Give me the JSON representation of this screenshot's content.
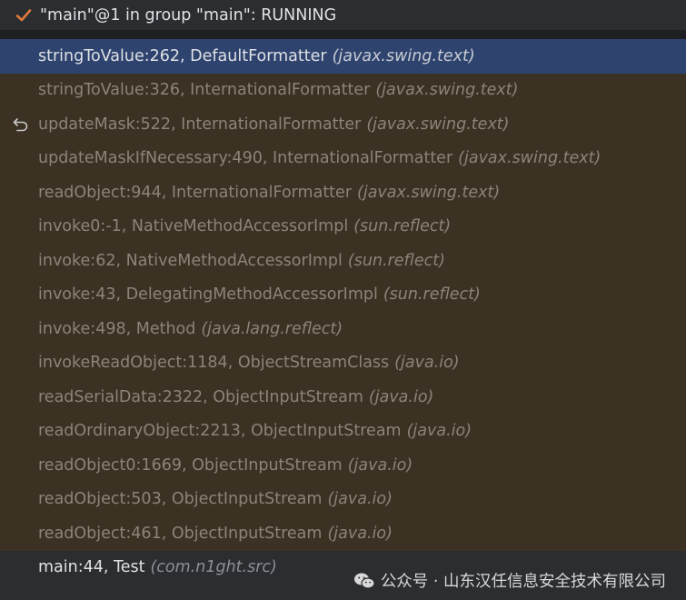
{
  "thread": {
    "title": "\"main\"@1 in group \"main\": RUNNING",
    "status_icon": "check-icon",
    "status_color": "#e07a3a"
  },
  "frames": [
    {
      "location": "stringToValue:262, DefaultFormatter",
      "package": "(javax.swing.text)",
      "kind": "selected"
    },
    {
      "location": "stringToValue:326, InternationalFormatter",
      "package": "(javax.swing.text)",
      "kind": "library"
    },
    {
      "location": "updateMask:522, InternationalFormatter",
      "package": "(javax.swing.text)",
      "kind": "library",
      "icon": "drop-frame-icon"
    },
    {
      "location": "updateMaskIfNecessary:490, InternationalFormatter",
      "package": "(javax.swing.text)",
      "kind": "library"
    },
    {
      "location": "readObject:944, InternationalFormatter",
      "package": "(javax.swing.text)",
      "kind": "library"
    },
    {
      "location": "invoke0:-1, NativeMethodAccessorImpl",
      "package": "(sun.reflect)",
      "kind": "library"
    },
    {
      "location": "invoke:62, NativeMethodAccessorImpl",
      "package": "(sun.reflect)",
      "kind": "library"
    },
    {
      "location": "invoke:43, DelegatingMethodAccessorImpl",
      "package": "(sun.reflect)",
      "kind": "library"
    },
    {
      "location": "invoke:498, Method",
      "package": "(java.lang.reflect)",
      "kind": "library"
    },
    {
      "location": "invokeReadObject:1184, ObjectStreamClass",
      "package": "(java.io)",
      "kind": "library"
    },
    {
      "location": "readSerialData:2322, ObjectInputStream",
      "package": "(java.io)",
      "kind": "library"
    },
    {
      "location": "readOrdinaryObject:2213, ObjectInputStream",
      "package": "(java.io)",
      "kind": "library"
    },
    {
      "location": "readObject0:1669, ObjectInputStream",
      "package": "(java.io)",
      "kind": "library"
    },
    {
      "location": "readObject:503, ObjectInputStream",
      "package": "(java.io)",
      "kind": "library"
    },
    {
      "location": "readObject:461, ObjectInputStream",
      "package": "(java.io)",
      "kind": "library"
    },
    {
      "location": "main:44, Test",
      "package": "(com.n1ght.src)",
      "kind": "user"
    }
  ],
  "watermark": {
    "text": "公众号 · 山东汉任信息安全技术有限公司",
    "icon": "wechat-icon"
  },
  "colors": {
    "selected_bg": "#2e436e",
    "library_bg": "#3b3224",
    "library_text": "#8b8578",
    "panel_bg": "#2b2d30"
  }
}
